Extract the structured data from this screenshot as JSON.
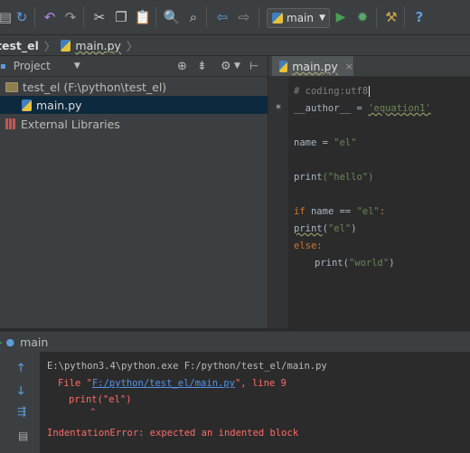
{
  "toolbar": {
    "run_config_label": "main",
    "help_label": "?"
  },
  "breadcrumb": {
    "project": "test_el",
    "file": "main.py"
  },
  "project_panel": {
    "title": "Project",
    "root_label": "test_el",
    "root_path": "(F:\\python\\test_el)",
    "file_item": "main.py",
    "libraries": "External Libraries"
  },
  "editor": {
    "tab_label": "main.py",
    "tab_close": "×",
    "gutter_marker": "*",
    "lines": {
      "l1": "# coding:utf8",
      "l2_name": "__author__",
      "l2_eq": " = ",
      "l2_val": "'equation1'",
      "l3_name": "name = ",
      "l3_val": "\"el\"",
      "l4_fn": "print",
      "l4_arg": "(\"hello\")",
      "l5_kw": "if",
      "l5_mid": " name == ",
      "l5_val": "\"el\"",
      "l5_colon": ":",
      "l6_fn": "print",
      "l6_open": "(",
      "l6_val": "\"el\"",
      "l6_close": ")",
      "l7_kw": "else",
      "l7_colon": ":",
      "l8_fn": "print",
      "l8_open": "(",
      "l8_val": "\"world\"",
      "l8_close": ")"
    }
  },
  "run_panel": {
    "title": "main",
    "console": {
      "command": "E:\\python3.4\\python.exe F:/python/test_el/main.py",
      "file_prefix": "File \"",
      "file_link": "F:/python/test_el/main.py",
      "file_suffix": "\", line 9",
      "code_line": "print(\"el\")",
      "caret": "^",
      "error": "IndentationError: expected an indented block"
    }
  },
  "colors": {
    "background": "#2b2b2b",
    "panel": "#3c3f41",
    "keyword": "#cc7832",
    "string": "#6a8759",
    "error": "#ff6b68",
    "link": "#5394ec",
    "run_green": "#499c54"
  }
}
